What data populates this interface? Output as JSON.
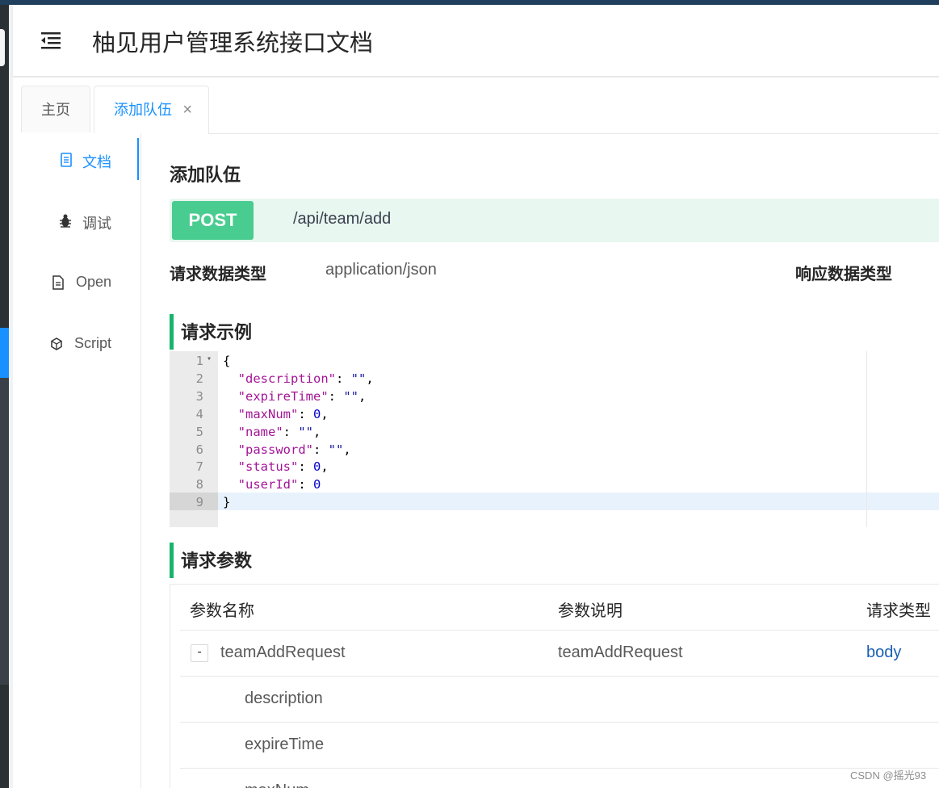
{
  "header": {
    "title": "柚见用户管理系统接口文档",
    "menu_icon": "menu-fold-icon"
  },
  "tabs": [
    {
      "label": "主页",
      "active": false
    },
    {
      "label": "添加队伍",
      "active": true,
      "close_glyph": "×"
    }
  ],
  "sidebar": {
    "items": [
      {
        "label": "文档",
        "icon": "file-icon",
        "active": true
      },
      {
        "label": "调试",
        "icon": "bug-icon",
        "active": false
      },
      {
        "label": "Open",
        "icon": "file-text-icon",
        "active": false
      },
      {
        "label": "Script",
        "icon": "code-sandbox-icon",
        "active": false
      }
    ]
  },
  "api": {
    "title": "添加队伍",
    "method": "POST",
    "path": "/api/team/add",
    "request_type_label": "请求数据类型",
    "request_type_value": "application/json",
    "response_type_label": "响应数据类型"
  },
  "example": {
    "section_title": "请求示例",
    "line_numbers": [
      "1",
      "2",
      "3",
      "4",
      "5",
      "6",
      "7",
      "8",
      "9"
    ],
    "lines": [
      {
        "pre": "{"
      },
      {
        "pre": "  ",
        "key": "\"description\"",
        "mid": ": ",
        "val": "\"\"",
        "post": ",",
        "vtype": "s"
      },
      {
        "pre": "  ",
        "key": "\"expireTime\"",
        "mid": ": ",
        "val": "\"\"",
        "post": ",",
        "vtype": "s"
      },
      {
        "pre": "  ",
        "key": "\"maxNum\"",
        "mid": ": ",
        "val": "0",
        "post": ",",
        "vtype": "n"
      },
      {
        "pre": "  ",
        "key": "\"name\"",
        "mid": ": ",
        "val": "\"\"",
        "post": ",",
        "vtype": "s"
      },
      {
        "pre": "  ",
        "key": "\"password\"",
        "mid": ": ",
        "val": "\"\"",
        "post": ",",
        "vtype": "s"
      },
      {
        "pre": "  ",
        "key": "\"status\"",
        "mid": ": ",
        "val": "0",
        "post": ",",
        "vtype": "n"
      },
      {
        "pre": "  ",
        "key": "\"userId\"",
        "mid": ": ",
        "val": "0",
        "post": "",
        "vtype": "n"
      },
      {
        "pre": "}"
      }
    ]
  },
  "params": {
    "section_title": "请求参数",
    "headers": [
      "参数名称",
      "参数说明",
      "请求类型"
    ],
    "rows": [
      {
        "name": "teamAddRequest",
        "desc": "teamAddRequest",
        "type": "body",
        "toggle": "-"
      },
      {
        "name": "description",
        "desc": "",
        "type": ""
      },
      {
        "name": "expireTime",
        "desc": "",
        "type": ""
      },
      {
        "name": "maxNum",
        "desc": "",
        "type": ""
      }
    ]
  },
  "watermark": "CSDN @摇光93"
}
